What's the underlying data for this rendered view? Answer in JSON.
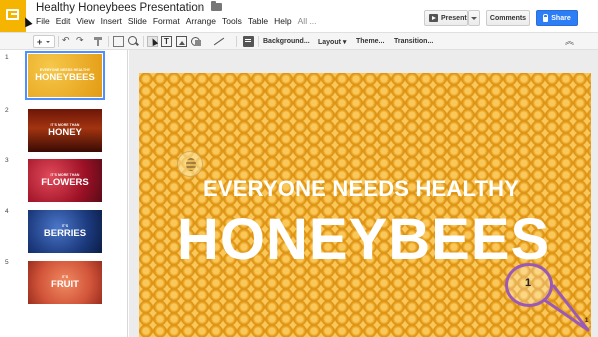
{
  "app": {
    "title": "Healthy Honeybees Presentation",
    "icons": {
      "logo": "slides-logo-icon",
      "star": "star-icon",
      "folder": "folder-icon",
      "cursor": "mouse-pointer-icon"
    }
  },
  "menu": [
    "File",
    "Edit",
    "View",
    "Insert",
    "Slide",
    "Format",
    "Arrange",
    "Tools",
    "Table",
    "Help",
    "All ..."
  ],
  "header_buttons": {
    "present": "Present",
    "comments": "Comments",
    "share": "Share"
  },
  "toolbar": {
    "add_slide": "+",
    "undo": "↶",
    "redo": "↷",
    "textbox": "T",
    "background": "Background...",
    "layout": "Layout ▾",
    "theme": "Theme...",
    "transition": "Transition...",
    "collapse": "︽"
  },
  "slides": [
    {
      "number": "1",
      "small": "EVERYONE NEEDS HEALTHY",
      "big": "HONEYBEES",
      "selected": true
    },
    {
      "number": "2",
      "small": "IT'S MORE THAN",
      "big": "HONEY"
    },
    {
      "number": "3",
      "small": "IT'S MORE THAN",
      "big": "FLOWERS"
    },
    {
      "number": "4",
      "small": "IT'S",
      "big": "BERRIES"
    },
    {
      "number": "5",
      "small": "IT'S",
      "big": "FRUIT"
    }
  ],
  "current_slide": {
    "subtitle": "EVERYONE NEEDS HEALTHY",
    "title": "HONEYBEES",
    "callout_label": "1",
    "callout_end_label": "1",
    "callout_color": "#9b59b6"
  },
  "colors": {
    "logo": "#f4b400",
    "share": "#2d7df6",
    "selection": "#4d90fe"
  }
}
